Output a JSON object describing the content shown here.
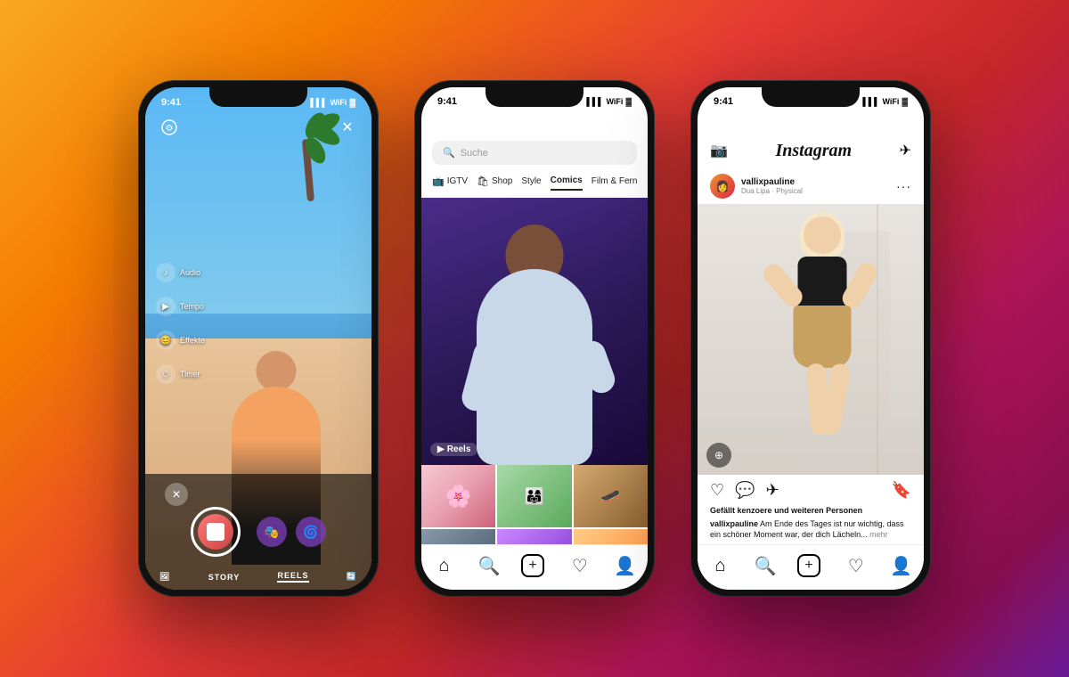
{
  "background": {
    "gradient": "linear-gradient(135deg, #f9a825, #e53935, #880e4f, #6a1b9a)"
  },
  "phone1": {
    "title": "Reels Recording",
    "status": {
      "time": "9:41",
      "signal": "▌▌▌",
      "wifi": "WiFi",
      "battery": "Battery"
    },
    "controls": [
      {
        "icon": "♪",
        "label": "Audio"
      },
      {
        "icon": "⏱",
        "label": "Tempo"
      },
      {
        "icon": "😊",
        "label": "Effekte"
      },
      {
        "icon": "⏰",
        "label": "Timer"
      }
    ],
    "bottom_tabs": [
      "STORY",
      "REELS"
    ]
  },
  "phone2": {
    "title": "Explore/Search",
    "status": {
      "time": "9:41"
    },
    "search": {
      "placeholder": "Suche"
    },
    "categories": [
      {
        "icon": "📺",
        "label": "IGTV"
      },
      {
        "icon": "🛍",
        "label": "Shop"
      },
      {
        "icon": "✨",
        "label": "Style"
      },
      {
        "icon": "📚",
        "label": "Comics"
      },
      {
        "icon": "🎬",
        "label": "Film & Fern"
      }
    ],
    "reels_label": "Reels",
    "nav_icons": [
      "🏠",
      "🔍",
      "➕",
      "♡",
      "👤"
    ]
  },
  "phone3": {
    "title": "Instagram Feed",
    "status": {
      "time": "9:41"
    },
    "header": {
      "logo": "Instagram",
      "camera_icon": "📷",
      "send_icon": "✈"
    },
    "post": {
      "username": "vallixpauline",
      "subtitle": "Dua Lipa · Physical",
      "more": "···",
      "likes_text": "Gefällt",
      "likes_bold": "kenzoere",
      "likes_suffix": "und weiteren Personen",
      "caption_username": "vallixpauline",
      "caption_text": "Am Ende des Tages ist nur wichtig, dass ein schöner Moment war, der dich Lächeln...",
      "caption_more": "mehr"
    },
    "nav_icons": [
      "🏠",
      "🔍",
      "➕",
      "♡",
      "👤"
    ]
  }
}
